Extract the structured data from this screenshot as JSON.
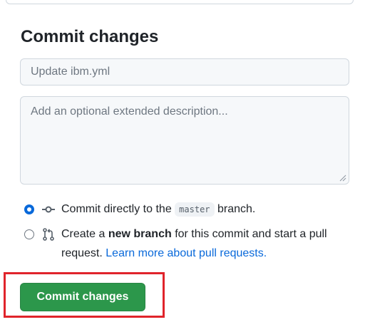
{
  "commit": {
    "title": "Commit changes",
    "summary_placeholder": "Update ibm.yml",
    "description_placeholder": "Add an optional extended description...",
    "options": [
      {
        "selected": true,
        "icon": "git-commit-icon",
        "text_before": "Commit directly to the",
        "branch": "master",
        "text_after": "branch."
      },
      {
        "selected": false,
        "icon": "git-pull-request-icon",
        "text_before": "Create a",
        "bold": "new branch",
        "text_after": "for this commit and start a pull request.",
        "link": "Learn more about pull requests."
      }
    ],
    "submit_label": "Commit changes"
  },
  "colors": {
    "button_green": "#2c974b",
    "link_blue": "#0969da",
    "highlight_red": "#e0242b"
  }
}
